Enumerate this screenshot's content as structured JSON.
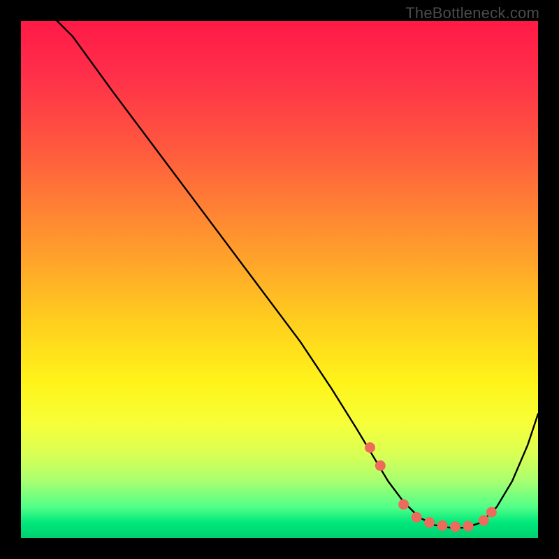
{
  "watermark": "TheBottleneck.com",
  "colors": {
    "marker": "#ee6a5b",
    "curve": "#000000"
  },
  "chart_data": {
    "type": "line",
    "title": "",
    "xlabel": "",
    "ylabel": "",
    "xlim": [
      0,
      100
    ],
    "ylim": [
      0,
      100
    ],
    "grid": false,
    "series": [
      {
        "name": "curve",
        "x": [
          7,
          10,
          18,
          27,
          36,
          45,
          54,
          60,
          65,
          68,
          71,
          74,
          77,
          80,
          83,
          86,
          89,
          92,
          95,
          98,
          100
        ],
        "y": [
          100,
          97,
          86,
          74,
          62,
          50,
          38,
          29,
          21,
          16,
          11,
          7,
          4,
          2.5,
          2,
          2,
          3,
          6,
          11,
          18,
          24
        ]
      }
    ],
    "markers": {
      "name": "highlight-points",
      "x": [
        67.5,
        69.5,
        74.0,
        76.5,
        79.0,
        81.5,
        84.0,
        86.5,
        89.5,
        91.0
      ],
      "y": [
        17.5,
        14.0,
        6.5,
        4.0,
        3.0,
        2.4,
        2.2,
        2.3,
        3.4,
        5.0
      ]
    }
  }
}
